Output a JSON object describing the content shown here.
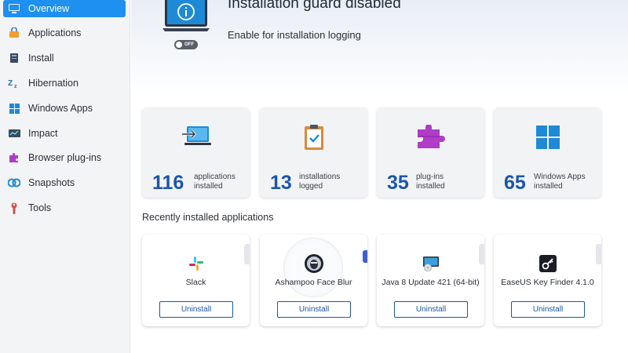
{
  "sidebar": {
    "items": [
      {
        "label": "Overview",
        "icon": "monitor-icon",
        "active": true
      },
      {
        "label": "Applications",
        "icon": "applications-icon"
      },
      {
        "label": "Install",
        "icon": "install-icon"
      },
      {
        "label": "Hibernation",
        "icon": "hibernation-icon"
      },
      {
        "label": "Windows Apps",
        "icon": "windows-icon"
      },
      {
        "label": "Impact",
        "icon": "impact-icon"
      },
      {
        "label": "Browser plug-ins",
        "icon": "puzzle-icon"
      },
      {
        "label": "Snapshots",
        "icon": "snapshots-icon"
      },
      {
        "label": "Tools",
        "icon": "tools-icon"
      }
    ]
  },
  "header": {
    "title": "Installation guard disabled",
    "subtitle": "Enable for installation logging",
    "toggle_label": "OFF",
    "toggle_on": false
  },
  "stats": [
    {
      "value": "116",
      "label_line1": "applications",
      "label_line2": "installed",
      "icon": "laptop-import-icon"
    },
    {
      "value": "13",
      "label_line1": "installations",
      "label_line2": "logged",
      "icon": "clipboard-check-icon"
    },
    {
      "value": "35",
      "label_line1": "plug-ins",
      "label_line2": "installed",
      "icon": "puzzle-icon"
    },
    {
      "value": "65",
      "label_line1": "Windows Apps",
      "label_line2": "installed",
      "icon": "windows-logo-icon"
    }
  ],
  "recent": {
    "title": "Recently installed applications",
    "apps": [
      {
        "name": "Slack",
        "icon": "slack-icon",
        "button": "Uninstall"
      },
      {
        "name": "Ashampoo Face Blur",
        "icon": "face-blur-icon",
        "button": "Uninstall"
      },
      {
        "name": "Java 8 Update 421 (64-bit)",
        "icon": "java-icon",
        "button": "Uninstall"
      },
      {
        "name": "EaseUS Key Finder 4.1.0",
        "icon": "key-icon",
        "button": "Uninstall"
      }
    ]
  },
  "colors": {
    "accent": "#1e90f0",
    "stat_number": "#1b56a8",
    "button_border": "#1b56a8"
  }
}
